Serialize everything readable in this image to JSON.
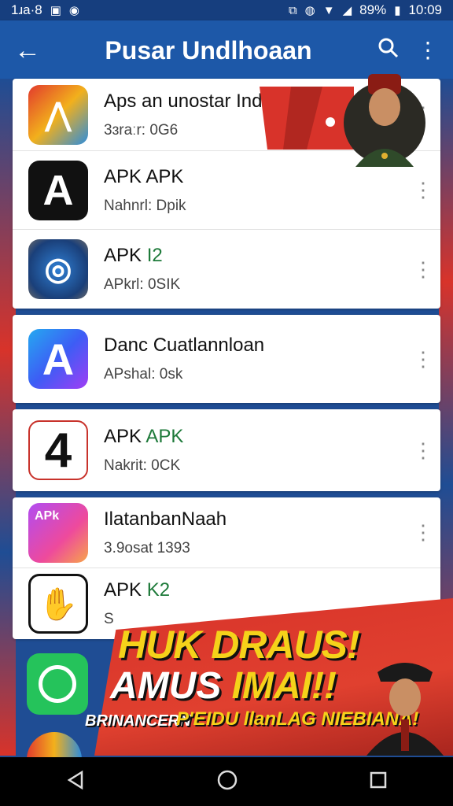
{
  "status_bar": {
    "left_text": "1ɹa·8",
    "time": "10:09",
    "battery": "89%"
  },
  "app_bar": {
    "title": "Pusar Undlhoaan",
    "back_icon": "arrow-left-icon",
    "search_icon": "search-icon",
    "menu_icon": "more-vert-icon"
  },
  "apps": [
    {
      "name": "Aps an unostar Indonesia",
      "sub": "3ɜraːr: 0G6",
      "icon": "apk-logo-icon"
    },
    {
      "name": "APK APK",
      "sub": "Nahnrl: Dpik",
      "icon": "apk-a-pin-icon"
    },
    {
      "name_a": "APK ",
      "name_b": "I2",
      "sub": "APkrl: 0SIK",
      "icon": "globe-badge-icon"
    },
    {
      "name": "Danc Cuatlannloan",
      "sub": "APshal: 0sk",
      "icon": "a-logo-icon"
    },
    {
      "name_a": "APK ",
      "name_b": "APK",
      "sub": "Nakrit: 0CK",
      "icon": "number-four-icon"
    },
    {
      "name": "IlatanbanNaah",
      "sub": "3.9osat 1393",
      "icon": "apk-chat-icon"
    },
    {
      "name_a": "APK ",
      "name_b": "K2",
      "sub": "S",
      "icon": "hand-logo-icon"
    }
  ],
  "promo": {
    "line1": "HUK DRAUS!",
    "line2a": "AMUS ",
    "line2b": "IMAI!!",
    "line3": "BRINANCERN",
    "line4": "P'EIDU llanLAG NIEBIANA!"
  },
  "nav": {
    "back": "back-triangle-icon",
    "home": "home-circle-icon",
    "recents": "recents-square-icon"
  }
}
